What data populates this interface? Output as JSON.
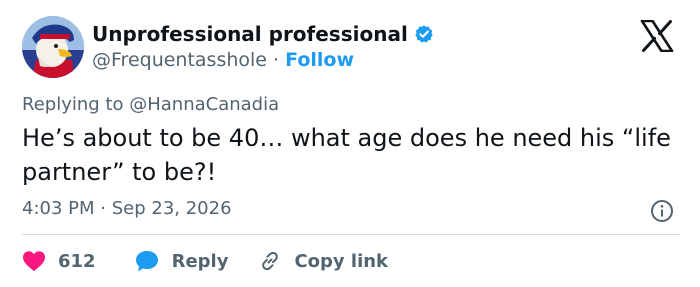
{
  "author": {
    "display_name": "Unprofessional professional",
    "handle": "@Frequentasshole",
    "separator": "·",
    "follow_label": "Follow"
  },
  "reply": {
    "prefix": "Replying to",
    "to_handle": "@HannaCanadia"
  },
  "tweet": {
    "text": "He’s about to be 40… what age does he need his “life partner” to be?!",
    "time": "4:03 PM",
    "date_separator": "·",
    "date": "Sep 23, 2026"
  },
  "actions": {
    "like_count": "612",
    "reply_label": "Reply",
    "copy_link_label": "Copy link"
  },
  "icons": {
    "verified": "verified-badge-icon",
    "platform": "x-logo-icon",
    "info": "info-icon",
    "like": "heart-icon",
    "reply": "speech-bubble-icon",
    "link": "link-icon"
  },
  "colors": {
    "accent": "#1d9bf0",
    "like": "#f91880",
    "text": "#0f1419",
    "secondary": "#536471",
    "divider": "#cfd9de"
  }
}
